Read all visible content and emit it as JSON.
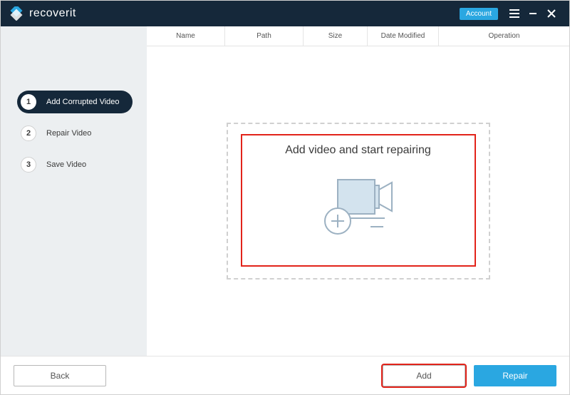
{
  "titlebar": {
    "brand": "recoverit",
    "account_label": "Account"
  },
  "sidebar": {
    "steps": [
      {
        "num": "1",
        "label": "Add Corrupted Video",
        "active": true
      },
      {
        "num": "2",
        "label": "Repair Video",
        "active": false
      },
      {
        "num": "3",
        "label": "Save Video",
        "active": false
      }
    ]
  },
  "table": {
    "columns": {
      "name": "Name",
      "path": "Path",
      "size": "Size",
      "date_modified": "Date Modified",
      "operation": "Operation"
    }
  },
  "drop": {
    "title": "Add video and start repairing"
  },
  "footer": {
    "back": "Back",
    "add": "Add",
    "repair": "Repair"
  }
}
